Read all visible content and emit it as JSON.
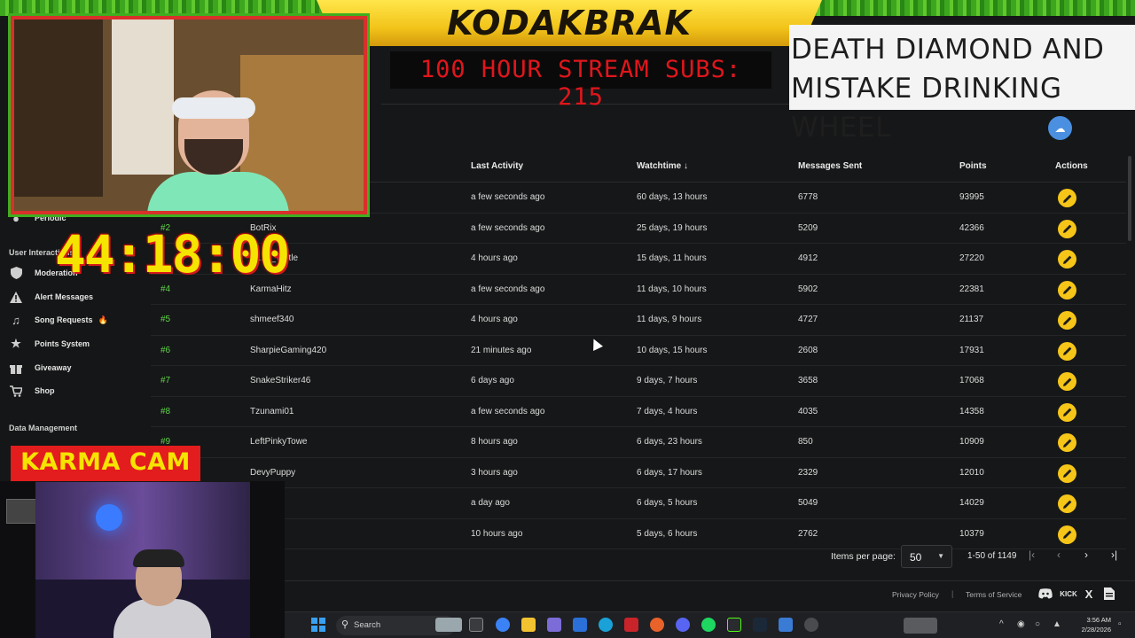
{
  "sidebar": {
    "partial_label": "Periodic",
    "section_user": "User Interactions",
    "items": [
      {
        "label": "Moderation",
        "icon": "shield-icon"
      },
      {
        "label": "Alert Messages",
        "icon": "warning-icon"
      },
      {
        "label": "Song Requests",
        "icon": "music-icon",
        "badge": "fire-icon"
      },
      {
        "label": "Points System",
        "icon": "star-icon"
      },
      {
        "label": "Giveaway",
        "icon": "gift-icon"
      },
      {
        "label": "Shop",
        "icon": "cart-icon"
      }
    ],
    "section_data": "Data Management"
  },
  "table": {
    "headers": {
      "last_activity": "Last Activity",
      "watchtime": "Watchtime",
      "messages_sent": "Messages Sent",
      "points": "Points",
      "actions": "Actions"
    },
    "sort_icon": "arrow-down-icon",
    "rows": [
      {
        "rank": "",
        "username": "",
        "last_activity": "a few seconds ago",
        "watchtime": "60 days, 13 hours",
        "messages": "6778",
        "points": "93995"
      },
      {
        "rank": "#2",
        "username": "BotRix",
        "last_activity": "a few seconds ago",
        "watchtime": "25 days, 19 hours",
        "messages": "5209",
        "points": "42366"
      },
      {
        "rank": "",
        "username": "A...nt_Turtle",
        "last_activity": "4 hours ago",
        "watchtime": "15 days, 11 hours",
        "messages": "4912",
        "points": "27220"
      },
      {
        "rank": "#4",
        "username": "KarmaHitz",
        "last_activity": "a few seconds ago",
        "watchtime": "11 days, 10 hours",
        "messages": "5902",
        "points": "22381"
      },
      {
        "rank": "#5",
        "username": "shmeef340",
        "last_activity": "4 hours ago",
        "watchtime": "11 days, 9 hours",
        "messages": "4727",
        "points": "21137"
      },
      {
        "rank": "#6",
        "username": "SharpieGaming420",
        "last_activity": "21 minutes ago",
        "watchtime": "10 days, 15 hours",
        "messages": "2608",
        "points": "17931"
      },
      {
        "rank": "#7",
        "username": "SnakeStriker46",
        "last_activity": "6 days ago",
        "watchtime": "9 days, 7 hours",
        "messages": "3658",
        "points": "17068"
      },
      {
        "rank": "#8",
        "username": "Tzunami01",
        "last_activity": "a few seconds ago",
        "watchtime": "7 days, 4 hours",
        "messages": "4035",
        "points": "14358"
      },
      {
        "rank": "#9",
        "username": "LeftPinkyTowe",
        "last_activity": "8 hours ago",
        "watchtime": "6 days, 23 hours",
        "messages": "850",
        "points": "10909"
      },
      {
        "rank": "",
        "username": "DevyPuppy",
        "last_activity": "3 hours ago",
        "watchtime": "6 days, 17 hours",
        "messages": "2329",
        "points": "12010"
      },
      {
        "rank": "",
        "username": "...eeps",
        "last_activity": "a day ago",
        "watchtime": "6 days, 5 hours",
        "messages": "5049",
        "points": "14029"
      },
      {
        "rank": "",
        "username": "",
        "last_activity": "10 hours ago",
        "watchtime": "5 days, 6 hours",
        "messages": "2762",
        "points": "10379"
      }
    ],
    "edit_icon": "pencil-icon"
  },
  "pagination": {
    "items_per_page_label": "Items per page:",
    "items_per_page_value": "50",
    "range": "1-50 of 1149"
  },
  "footer": {
    "privacy": "Privacy Policy",
    "separator": "|",
    "terms": "Terms of Service",
    "social_icons": [
      "discord-icon",
      "kick-icon",
      "x-icon",
      "document-icon"
    ],
    "kick_text": "KICK",
    "x_text": "X"
  },
  "taskbar": {
    "search_placeholder": "Search",
    "time": "3:56 AM",
    "date": "2/28/2026"
  },
  "overlays": {
    "channel_title": "KODAKBRAK",
    "subs_banner": "100 HOUR STREAM SUBS: 215",
    "wheel_banner": "DEATH DIAMOND AND MISTAKE DRINKING WHEEL",
    "timer": "44:18:00",
    "karma_cam": "KARMA CAM"
  },
  "colors": {
    "accent_green": "#5fd34a",
    "edit_button": "#f5c518",
    "fab_blue": "#4a8fe0",
    "banner_red": "#e31d1d",
    "timer_yellow": "#f5e400"
  }
}
